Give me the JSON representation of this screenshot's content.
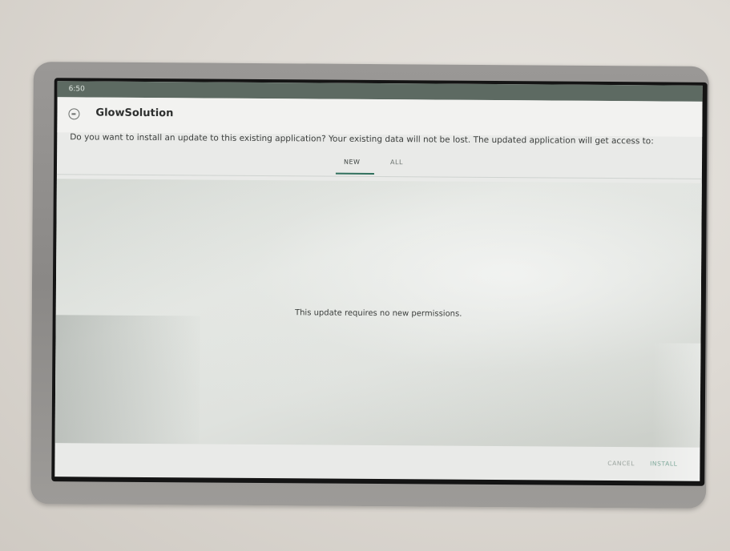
{
  "status_bar": {
    "time": "6:50"
  },
  "app": {
    "icon": "app-logo-icon",
    "title": "GlowSolution"
  },
  "prompt": "Do you want to install an update to this existing application? Your existing data will not be lost. The updated application will get access to:",
  "tabs": [
    {
      "label": "NEW",
      "selected": true
    },
    {
      "label": "ALL",
      "selected": false
    }
  ],
  "message": "This update requires no new permissions.",
  "actions": {
    "cancel_label": "CANCEL",
    "install_label": "INSTALL"
  },
  "colors": {
    "accent": "#2f6f5c",
    "status_bar": "#5d6a62",
    "screen_background": "#e9eae8"
  }
}
